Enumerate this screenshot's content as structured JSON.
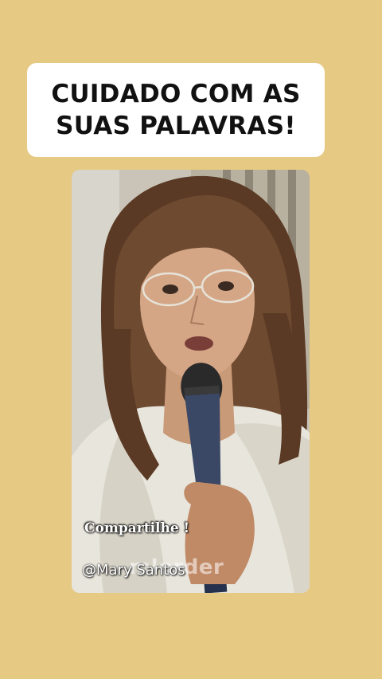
{
  "colors": {
    "background": "#e6c983",
    "title_card": "#ffffff",
    "title_text": "#111111",
    "caption_text": "#ffffff"
  },
  "title": {
    "line1": "CUIDADO COM AS",
    "line2": "SUAS PALAVRAS!"
  },
  "video": {
    "caption": "Compartilhe !",
    "handle": "@Mary Santos",
    "watermark": "mlorder"
  }
}
